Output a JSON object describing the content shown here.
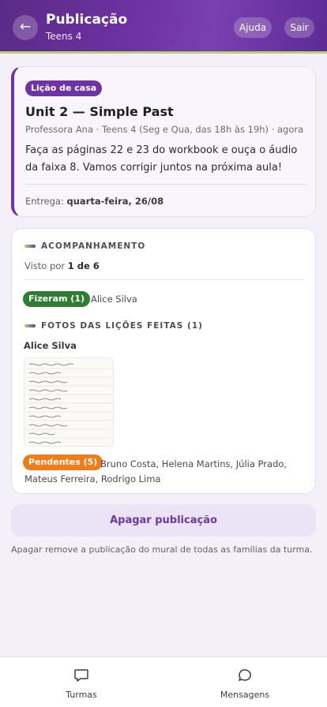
{
  "header": {
    "title": "Publicação",
    "subtitle": "Teens 4",
    "back_icon": "←",
    "help_label": "Ajuda",
    "logout_label": "Sair",
    "accent": "#6f33a6",
    "underline_color": "#b7d36a"
  },
  "lesson": {
    "badge": "Lição de casa",
    "title": "Unit 2 — Simple Past",
    "meta": "Professora Ana · Teens 4 (Seg e Qua, das 18h às 19h) · agora",
    "body": "Faça as páginas 22 e 23 do workbook e ouça o áudio da faixa 8. Vamos corrigir juntos na próxima aula!",
    "due_label": "Entrega:",
    "due_value": "quarta-feira, 26/08"
  },
  "tracking": {
    "section_title": "ACOMPANHAMENTO",
    "seen_prefix": "Visto por",
    "seen_value": "1 de 6",
    "done_badge": "Fizeram (1)",
    "done_names": "Alice Silva",
    "done_color": "#2f7d32",
    "photos_title": "FOTOS DAS LIÇÕES FEITAS (1)",
    "photo_student": "Alice Silva",
    "pending_badge": "Pendentes (5)",
    "pending_names": "Bruno Costa, Helena Martins, Júlia Prado, Mateus Ferreira, Rodrigo Lima",
    "pending_color": "#ef7d1a"
  },
  "actions": {
    "delete_label": "Apagar publicação",
    "delete_note": "Apagar remove a publicação do mural de todas as famílias da turma."
  },
  "bottom_nav": {
    "items": [
      {
        "label": "Turmas",
        "icon": "chat-square-icon"
      },
      {
        "label": "Mensagens",
        "icon": "chat-bubble-icon"
      }
    ]
  }
}
